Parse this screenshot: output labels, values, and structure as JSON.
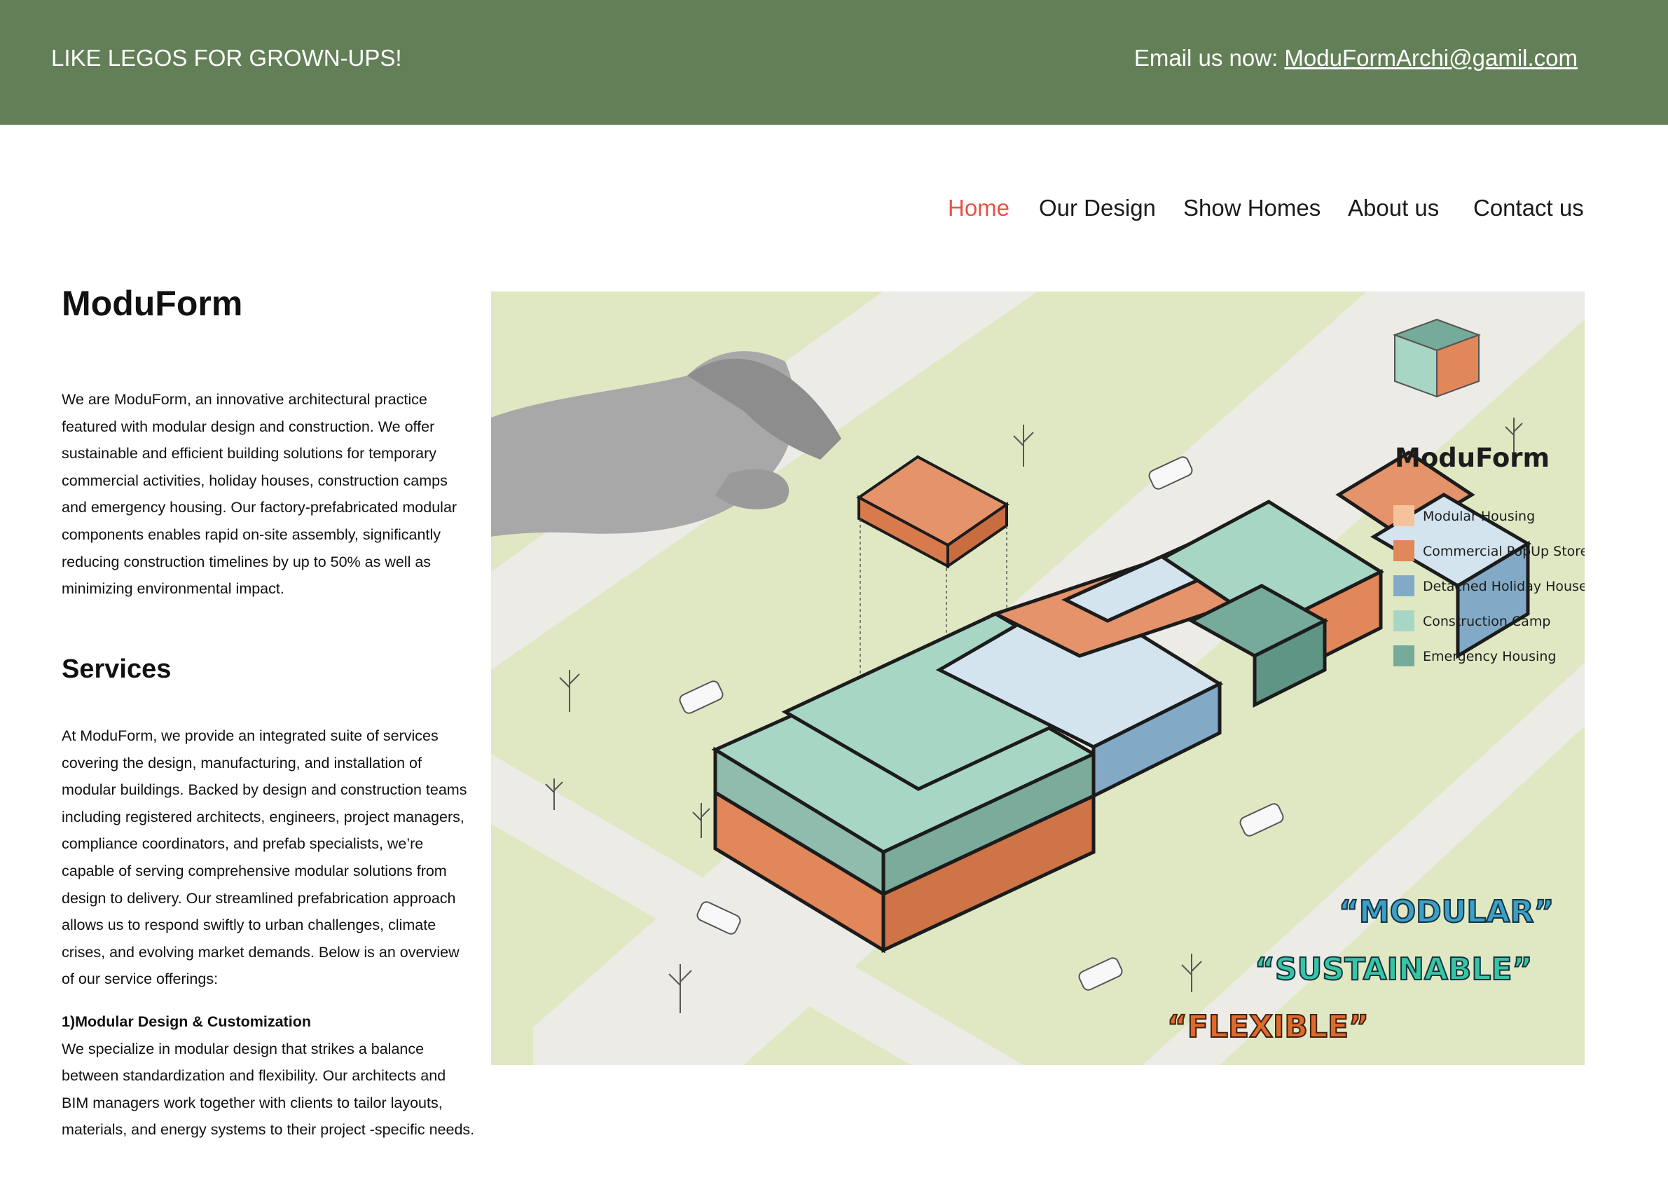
{
  "header": {
    "tagline": "LIKE LEGOS FOR GROWN-UPS!",
    "email_prefix": "Email us now:",
    "email": "ModuFormArchi@gamil.com",
    "bg_color": "#637f57"
  },
  "nav": {
    "items": [
      "Home",
      "Our Design",
      "Show Homes",
      "About us",
      "Contact us"
    ],
    "active": "Home",
    "active_color": "#e5534b"
  },
  "main": {
    "title": "ModuForm",
    "intro": "We are ModuForm, an innovative architectural practice featured with modular design and construction. We offer sustainable and efficient building solutions for temporary commercial activities, holiday houses, construction camps and emergency housing. Our factory-prefabricated modular components enables rapid on-site assembly, significantly reducing construction timelines by up to 50% as well as minimizing environmental impact.",
    "services_title": "Services",
    "services_intro": "At ModuForm, we provide an integrated suite of services covering the design, manufacturing, and installation of modular buildings. Backed by design and construction teams including registered architects, engineers, project managers, compliance coordinators, and prefab specialists, we’re capable of serving comprehensive modular solutions from design to delivery. Our streamlined prefabrication approach allows us to respond swiftly to urban challenges, climate crises, and evolving market demands. Below is an overview of our service offerings:",
    "service_1_title": "1)Modular Design & Customization",
    "service_1_text": "We specialize in modular design that strikes a balance between standardization and  flexibility. Our architects and BIM managers work together with clients to tailor layouts, materials, and energy systems to their project -specific needs."
  },
  "hero": {
    "brand": "ModuForm",
    "legend": [
      {
        "label": "Modular Housing",
        "color": "#f5c29c"
      },
      {
        "label": "Commercial PopUp Store",
        "color": "#e1875a"
      },
      {
        "label": "Detached Holiday House",
        "color": "#82aac6"
      },
      {
        "label": "Construction Camp",
        "color": "#a8d6c5"
      },
      {
        "label": "Emergency Housing",
        "color": "#76aa9a"
      }
    ],
    "slogans": [
      "“MODULAR”",
      "“SUSTAINABLE”",
      "“FLEXIBLE”"
    ],
    "slogan_colors": [
      "#3aa0c8",
      "#35c6a4",
      "#e06a2c"
    ]
  }
}
